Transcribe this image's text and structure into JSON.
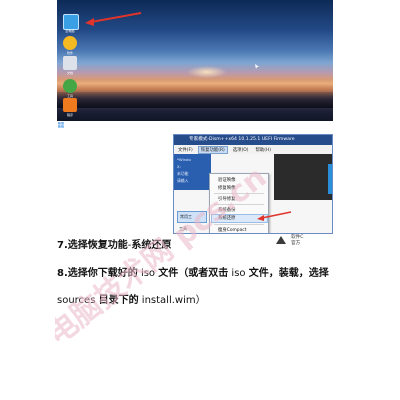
{
  "desktop": {
    "icon_labels": [
      "此电脑",
      "软件",
      "文档",
      "工具",
      "程序"
    ]
  },
  "window": {
    "title": "专家模式-Dism++x64 10.1.25.1 UEFI Firmware",
    "menu": [
      "文件(F)",
      "恢复功能(R)",
      "选项(O)",
      "帮助(H)"
    ],
    "body_lines": [
      "*Windo",
      "X:",
      "未功能",
      "请输入"
    ],
    "dropdown_items": [
      "验证映像",
      "修复映像",
      "引导修复",
      "系统备份",
      "系统还原",
      "瘦身Compact"
    ],
    "tool_button": "常用工",
    "tool_label": "工具"
  },
  "side": {
    "text1": "软件C",
    "text2": "官方"
  },
  "doc": {
    "p1_prefix": "7.选择恢复功能",
    "p1_mid": "-",
    "p1_suffix": "系统还原",
    "p2_a": "8.选择你下载好的",
    "p2_b": " iso ",
    "p2_c": "文件（或者双击",
    "p2_d": " iso ",
    "p2_e": "文件，装载，选择",
    "p3_a": "sources ",
    "p3_b": "目录下的",
    "p3_c": " install.wim",
    "p3_d": "）"
  },
  "watermark": {
    "text": "电脑技术网 pcs.cn"
  },
  "colors": {
    "arrow": "#e0342b",
    "watermark": "#e9b6c8",
    "window_title": "#264c8c"
  }
}
